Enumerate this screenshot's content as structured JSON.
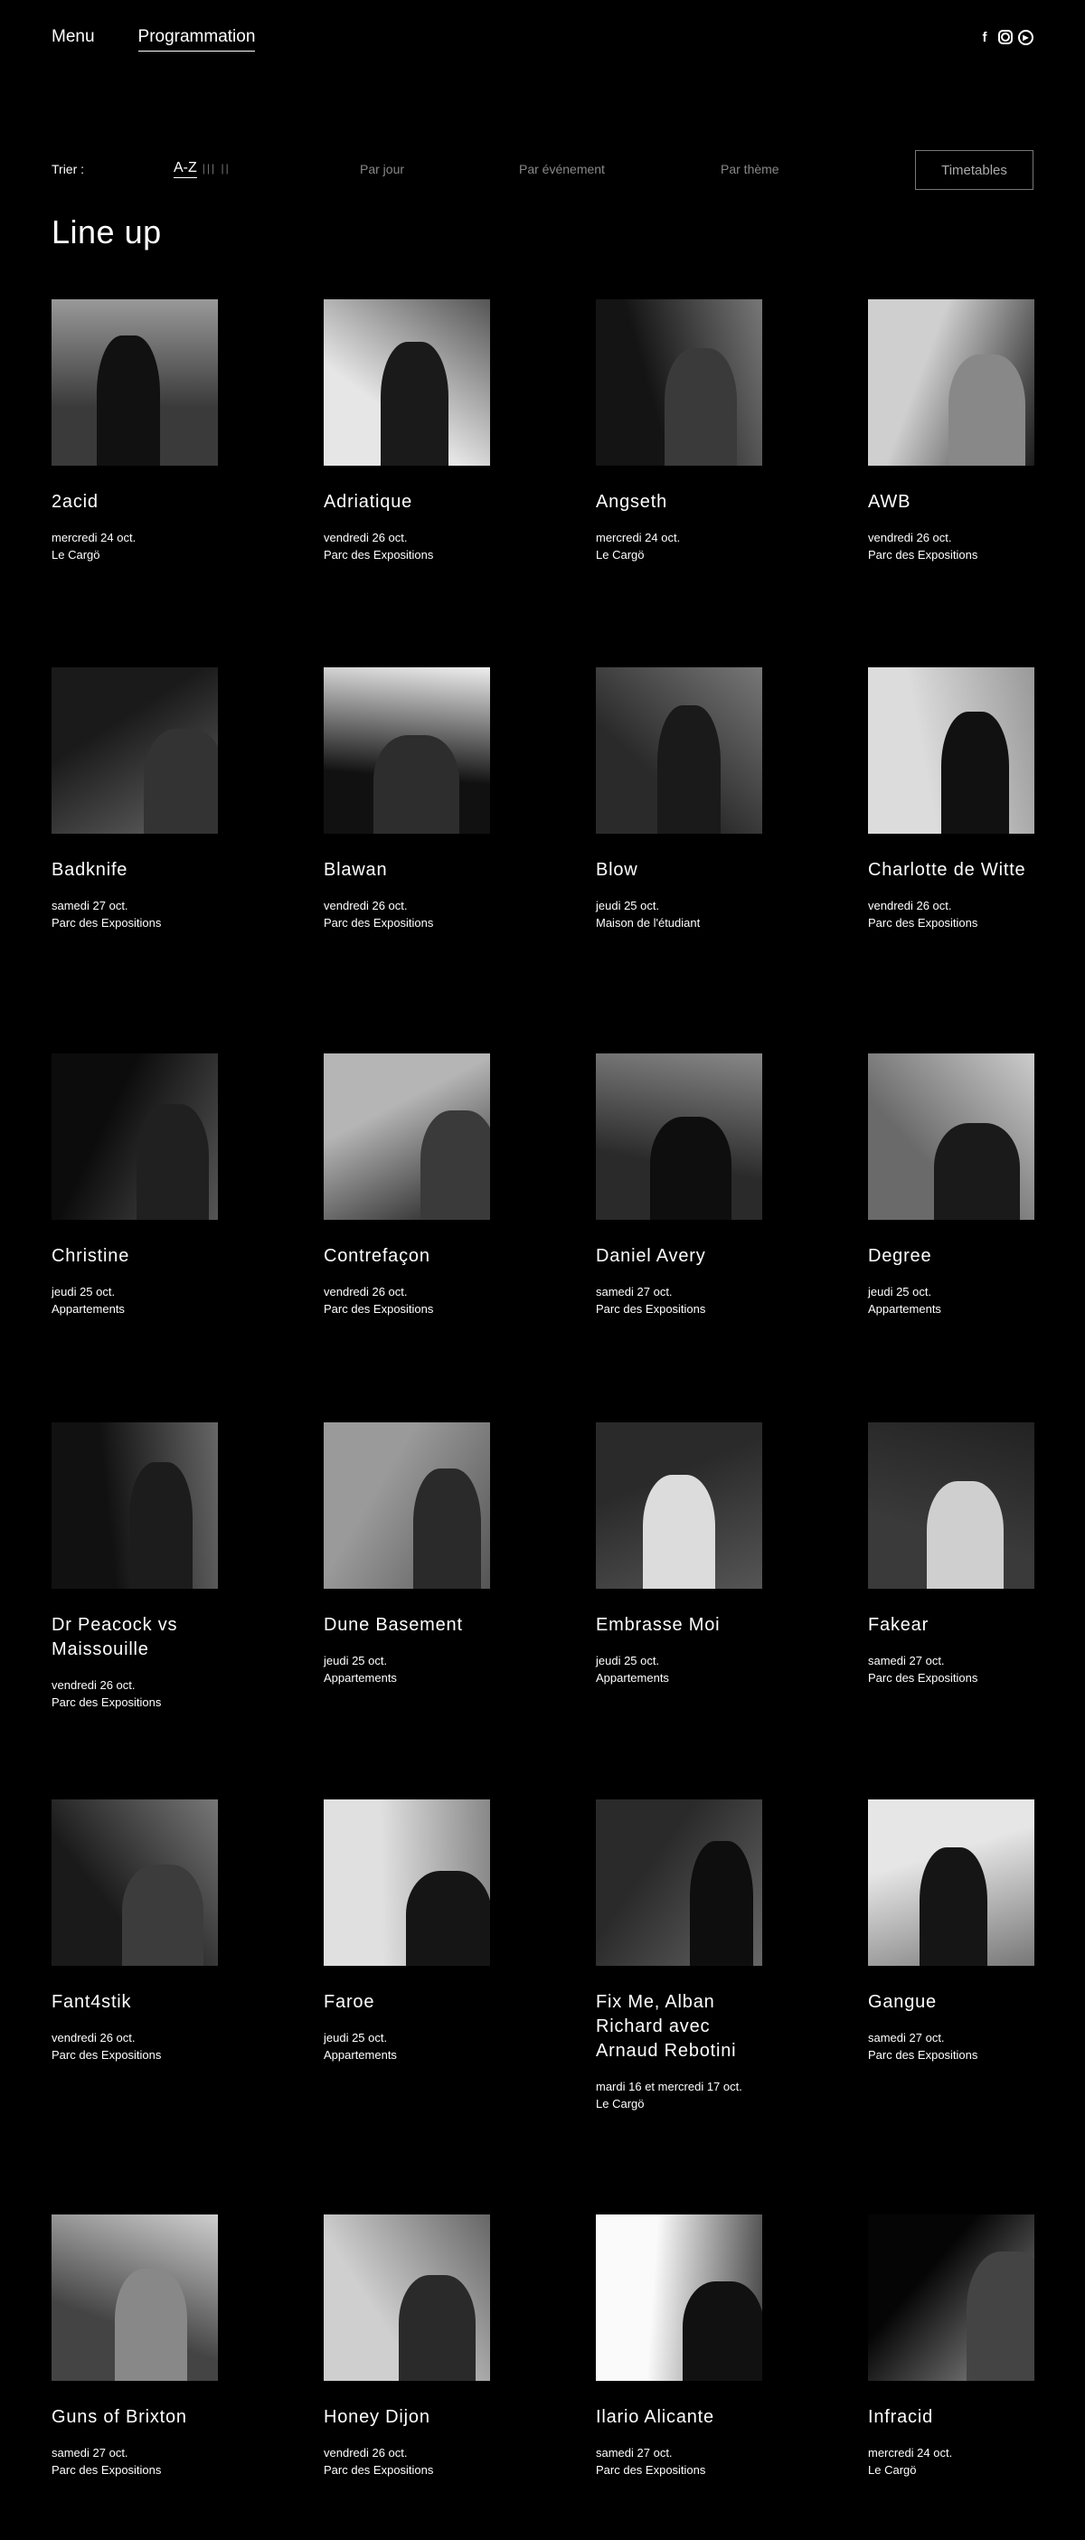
{
  "nav": {
    "menu": "Menu",
    "programmation": "Programmation"
  },
  "social": [
    "facebook-icon",
    "instagram-icon",
    "play-icon"
  ],
  "sort": {
    "label": "Trier :",
    "az": "A-Z",
    "options": [
      "Par jour",
      "Par événement",
      "Par thème"
    ],
    "timetables": "Timetables"
  },
  "title": "Line up",
  "artists": [
    {
      "name": "2acid",
      "date": "mercredi 24 oct.",
      "venue": "Le Cargö"
    },
    {
      "name": "Adriatique",
      "date": "vendredi 26 oct.",
      "venue": "Parc des Expositions"
    },
    {
      "name": "Angseth",
      "date": "mercredi 24 oct.",
      "venue": "Le Cargö"
    },
    {
      "name": "AWB",
      "date": "vendredi 26 oct.",
      "venue": "Parc des Expositions"
    },
    {
      "name": "Badknife",
      "date": "samedi 27 oct.",
      "venue": "Parc des Expositions"
    },
    {
      "name": "Blawan",
      "date": "vendredi 26 oct.",
      "venue": "Parc des Expositions"
    },
    {
      "name": "Blow",
      "date": "jeudi 25 oct.",
      "venue": "Maison de l'étudiant"
    },
    {
      "name": "Charlotte de Witte",
      "date": "vendredi 26 oct.",
      "venue": "Parc des Expositions"
    },
    {
      "name": "Christine",
      "date": "jeudi 25 oct.",
      "venue": "Appartements"
    },
    {
      "name": "Contrefaçon",
      "date": "vendredi 26 oct.",
      "venue": "Parc des Expositions"
    },
    {
      "name": "Daniel Avery",
      "date": "samedi 27 oct.",
      "venue": "Parc des Expositions"
    },
    {
      "name": "Degree",
      "date": "jeudi 25 oct.",
      "venue": "Appartements"
    },
    {
      "name": "Dr Peacock vs Maissouille",
      "date": "vendredi 26 oct.",
      "venue": "Parc des Expositions"
    },
    {
      "name": "Dune Basement",
      "date": "jeudi 25 oct.",
      "venue": "Appartements"
    },
    {
      "name": "Embrasse Moi",
      "date": "jeudi 25 oct.",
      "venue": "Appartements"
    },
    {
      "name": "Fakear",
      "date": "samedi 27 oct.",
      "venue": "Parc des Expositions"
    },
    {
      "name": "Fant4stik",
      "date": "vendredi 26 oct.",
      "venue": "Parc des Expositions"
    },
    {
      "name": "Faroe",
      "date": "jeudi 25 oct.",
      "venue": "Appartements"
    },
    {
      "name": "Fix Me, Alban Richard avec Arnaud Rebotini",
      "date": "mardi 16 et mercredi 17 oct.",
      "venue": "Le Cargö"
    },
    {
      "name": "Gangue",
      "date": "samedi 27 oct.",
      "venue": "Parc des Expositions"
    },
    {
      "name": "Guns of Brixton",
      "date": "samedi 27 oct.",
      "venue": "Parc des Expositions"
    },
    {
      "name": "Honey Dijon",
      "date": "vendredi 26 oct.",
      "venue": "Parc des Expositions"
    },
    {
      "name": "Ilario Alicante",
      "date": "samedi 27 oct.",
      "venue": "Parc des Expositions"
    },
    {
      "name": "Infracid",
      "date": "mercredi 24 oct.",
      "venue": "Le Cargö"
    }
  ]
}
